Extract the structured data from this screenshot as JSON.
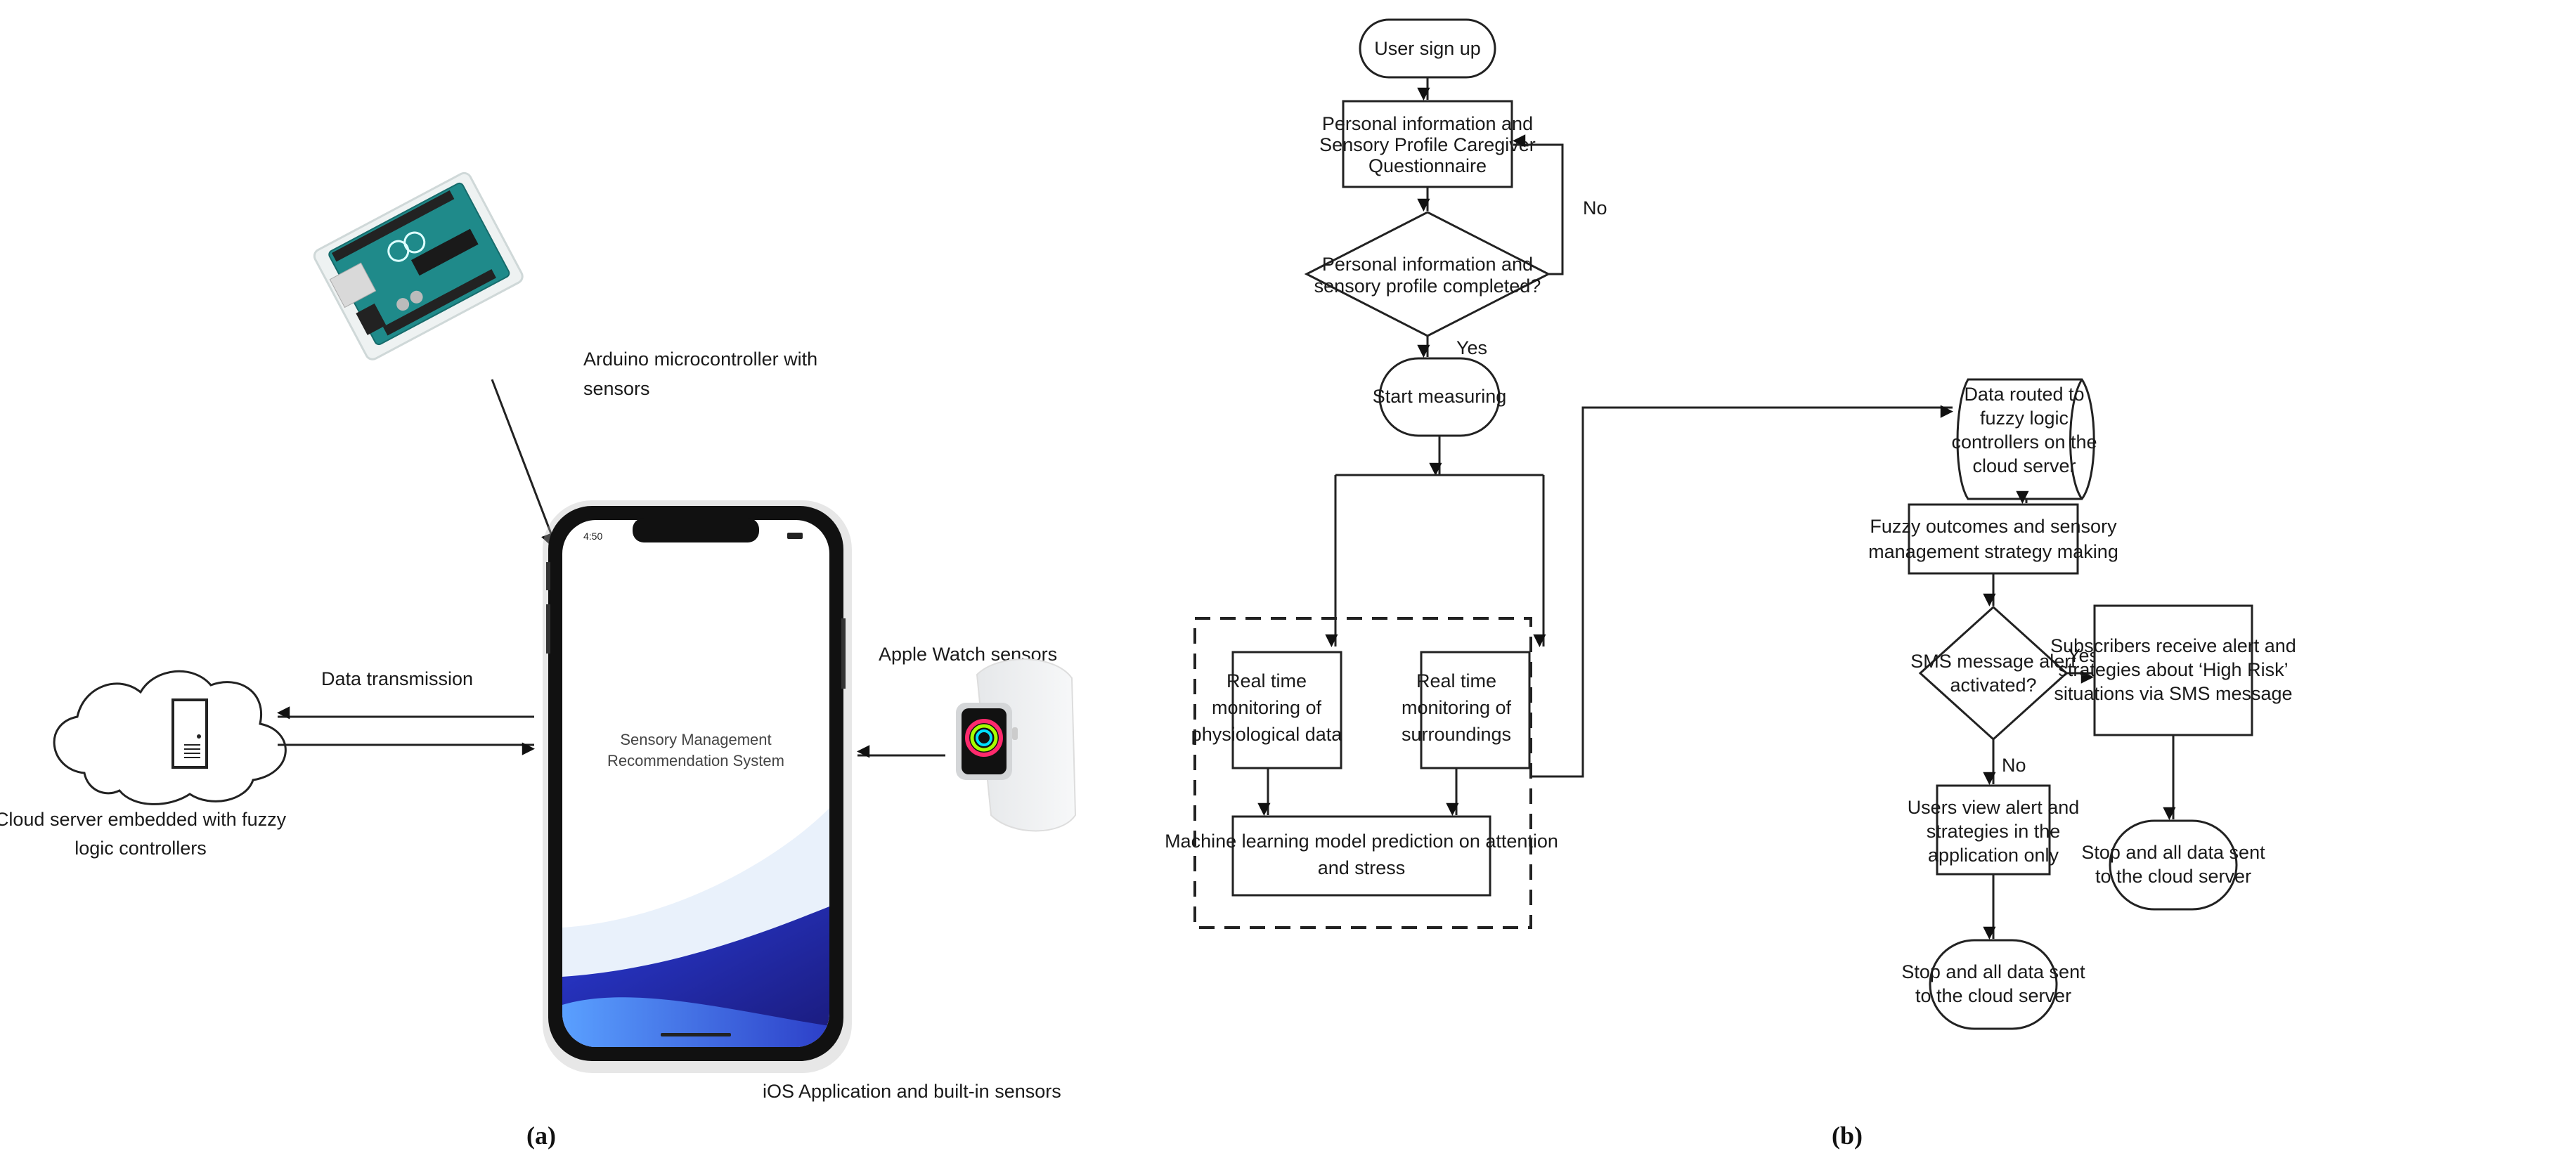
{
  "panel_a": {
    "label": "(a)",
    "arduino_caption": [
      "Arduino microcontroller with",
      "sensors"
    ],
    "watch_caption": "Apple Watch sensors",
    "transmission_label": "Data transmission",
    "cloud_caption": [
      "Cloud server embedded with fuzzy",
      "logic controllers"
    ],
    "phone_caption": "iOS Application and built-in sensors",
    "phone_status_time": "4:50",
    "phone_app_title": [
      "Sensory Management",
      "Recommendation System"
    ]
  },
  "panel_b": {
    "label": "(b)",
    "nodes": {
      "signup": [
        "User sign up"
      ],
      "questionnaire": [
        "Personal information and",
        "Sensory Profile Caregiver",
        "Questionnaire"
      ],
      "profile_check": [
        "Personal information and",
        "sensory profile completed?"
      ],
      "start": [
        "Start measuring"
      ],
      "physio": [
        "Real time",
        "monitoring of",
        "physiological data"
      ],
      "surround": [
        "Real time",
        "monitoring of",
        "surroundings"
      ],
      "ml": [
        "Machine learning model prediction on attention",
        "and stress"
      ],
      "routed": [
        "Data routed to",
        "fuzzy logic",
        "controllers on the",
        "cloud server"
      ],
      "fuzzy": [
        "Fuzzy outcomes and sensory",
        "management strategy making"
      ],
      "sms_check": [
        "SMS message alert",
        "activated?"
      ],
      "subscribers": [
        "Subscribers receive alert and",
        "strategies about ‘High Risk’",
        "situations via SMS message"
      ],
      "users_view": [
        "Users view alert and",
        "strategies in the",
        "application only"
      ],
      "stop_left": [
        "Stop and all data sent",
        "to the cloud server"
      ],
      "stop_right": [
        "Stop and all data sent",
        "to the cloud server"
      ]
    },
    "edge_labels": {
      "profile_no": "No",
      "profile_yes": "Yes",
      "sms_yes": "Yes",
      "sms_no": "No"
    }
  }
}
